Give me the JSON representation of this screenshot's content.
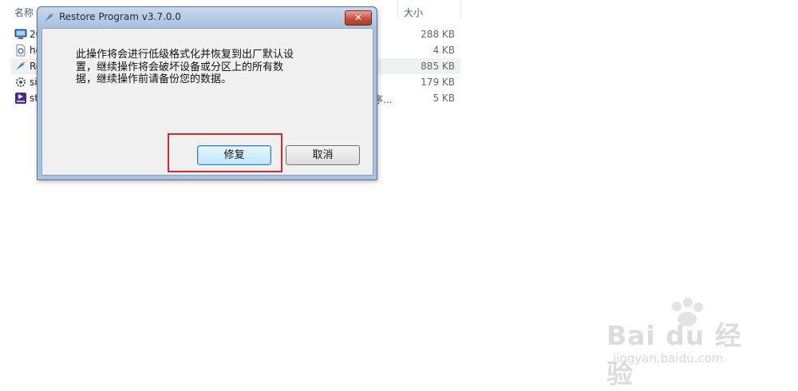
{
  "explorer": {
    "columns": {
      "name": "名称",
      "size": "大小"
    },
    "files": [
      {
        "name": "20",
        "extra": "",
        "size": "288 KB",
        "icon": "monitor-icon"
      },
      {
        "name": "ho",
        "extra": "",
        "size": "4 KB",
        "icon": "document-icon"
      },
      {
        "name": "Re",
        "extra": "",
        "size": "885 KB",
        "icon": "restore-program-icon"
      },
      {
        "name": "si",
        "extra": "",
        "size": "179 KB",
        "icon": "gear-icon"
      },
      {
        "name": "st",
        "extra": "序...",
        "size": "5 KB",
        "icon": "dat-file-icon"
      }
    ]
  },
  "dialog": {
    "title": "Restore Program v3.7.0.0",
    "close_label": "✕",
    "message": "此操作将会进行低级格式化并恢复到出厂默认设置，继续操作将会破坏设备或分区上的所有数据，继续操作前请备份您的数据。",
    "message_lines": [
      "此操作将会进行低级格式化并恢复到出厂默认设",
      "置，继续操作将会破坏设备或分区上的所有数",
      "据，继续操作前请备份您的数据。"
    ],
    "repair_label": "修复",
    "cancel_label": "取消"
  },
  "watermark": {
    "logo": "Bai du 经验",
    "url": "jingyan.baidu.com"
  },
  "colors": {
    "highlight": "#d9262b",
    "titlebar": "#a9c1de",
    "close": "#c7503a"
  }
}
